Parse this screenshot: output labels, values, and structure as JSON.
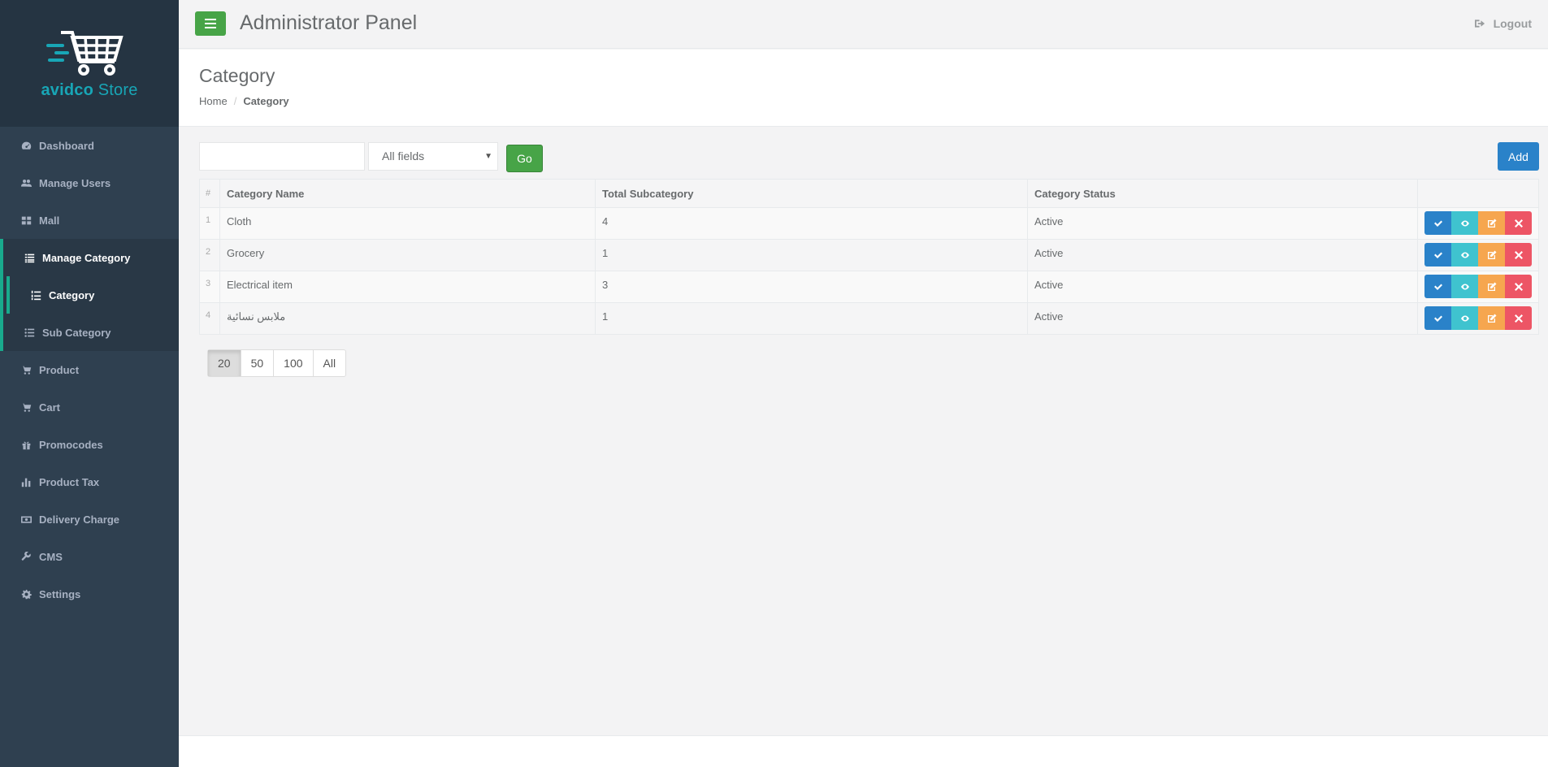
{
  "brand": {
    "name_part1": "avidco",
    "name_part2": " Store",
    "logo_icon": "shopping-cart-icon",
    "color": "#18a6b6"
  },
  "sidebar": {
    "items": [
      {
        "label": "Dashboard",
        "icon": "dashboard-icon"
      },
      {
        "label": "Manage Users",
        "icon": "users-icon"
      },
      {
        "label": "Mall",
        "icon": "grid-icon"
      },
      {
        "label": "Manage Category",
        "icon": "list-icon"
      },
      {
        "label": "Category",
        "icon": "list-ol-icon"
      },
      {
        "label": "Sub Category",
        "icon": "list-ul-icon"
      },
      {
        "label": "Product",
        "icon": "cart-plus-icon"
      },
      {
        "label": "Cart",
        "icon": "cart-icon"
      },
      {
        "label": "Promocodes",
        "icon": "gift-icon"
      },
      {
        "label": "Product Tax",
        "icon": "bar-chart-icon"
      },
      {
        "label": "Delivery Charge",
        "icon": "money-icon"
      },
      {
        "label": "CMS",
        "icon": "wrench-icon"
      },
      {
        "label": "Settings",
        "icon": "cog-icon"
      }
    ]
  },
  "header": {
    "title": "Administrator Panel",
    "logout_label": "Logout"
  },
  "page": {
    "title": "Category",
    "breadcrumb": [
      "Home",
      "Category"
    ]
  },
  "toolbar": {
    "search_value": "",
    "field_select": "All fields",
    "go_label": "Go",
    "add_label": "Add"
  },
  "table": {
    "columns": [
      "#",
      "Category Name",
      "Total Subcategory",
      "Category Status",
      ""
    ],
    "rows": [
      {
        "idx": "1",
        "name": "Cloth",
        "subcount": "4",
        "status": "Active"
      },
      {
        "idx": "2",
        "name": "Grocery",
        "subcount": "1",
        "status": "Active"
      },
      {
        "idx": "3",
        "name": "Electrical item",
        "subcount": "3",
        "status": "Active"
      },
      {
        "idx": "4",
        "name": "ملابس نسائية",
        "subcount": "1",
        "status": "Active"
      }
    ],
    "row_actions": [
      "check-icon",
      "eye-icon",
      "edit-icon",
      "close-icon"
    ]
  },
  "page_sizes": [
    "20",
    "50",
    "100",
    "All"
  ],
  "colors": {
    "sidebar": "#2f4050",
    "active_border": "#19aa8d",
    "go": "#47a447",
    "add": "#2a82c9",
    "action_blue": "#2a82c9",
    "action_teal": "#3fc3cf",
    "action_orange": "#f6a64f",
    "action_red": "#ed5565"
  }
}
